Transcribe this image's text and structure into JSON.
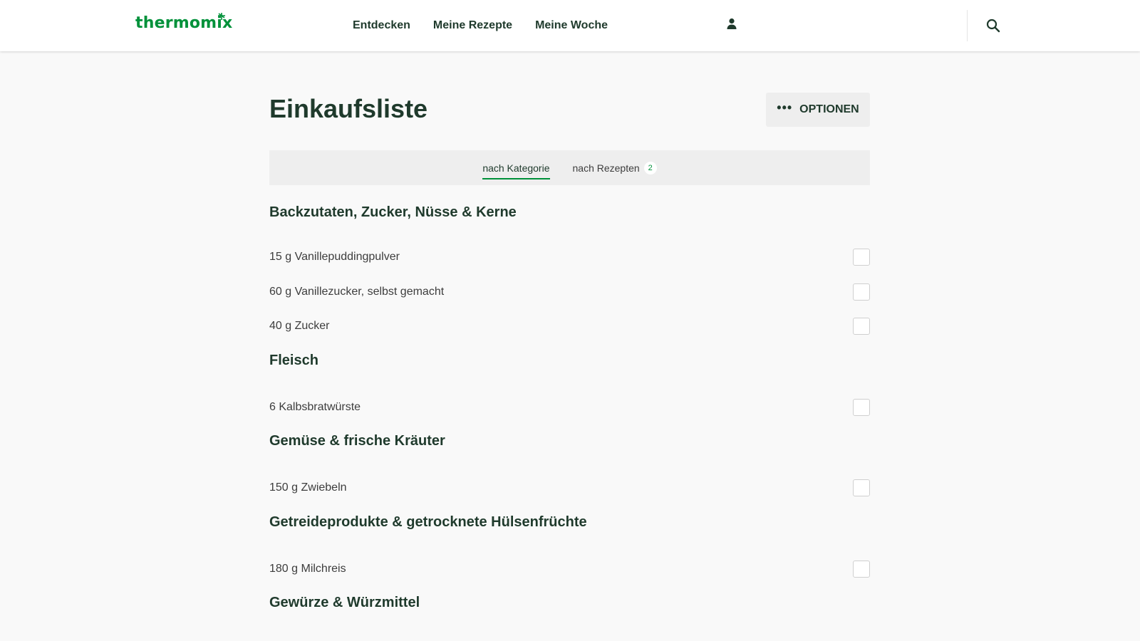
{
  "brand": {
    "logo_text": "thermomix",
    "color": "#00913a"
  },
  "nav": {
    "items": [
      {
        "label": "Entdecken"
      },
      {
        "label": "Meine Rezepte"
      },
      {
        "label": "Meine Woche"
      }
    ],
    "user_icon": "user-icon",
    "search_icon": "search-icon"
  },
  "page": {
    "title": "Einkaufsliste",
    "options_label": "OPTIONEN"
  },
  "tabs": [
    {
      "label": "nach Kategorie",
      "active": true
    },
    {
      "label": "nach Rezepten",
      "badge": "2",
      "active": false
    }
  ],
  "categories": [
    {
      "title": "Backzutaten, Zucker, Nüsse & Kerne",
      "items": [
        {
          "text": "15 g Vanillepuddingpulver",
          "checked": false
        },
        {
          "text": "60 g Vanillezucker, selbst gemacht",
          "checked": false
        },
        {
          "text": "40 g Zucker",
          "checked": false
        }
      ]
    },
    {
      "title": "Fleisch",
      "items": [
        {
          "text": "6 Kalbsbratwürste",
          "checked": false
        }
      ]
    },
    {
      "title": "Gemüse & frische Kräuter",
      "items": [
        {
          "text": "150 g Zwiebeln",
          "checked": false
        }
      ]
    },
    {
      "title": "Getreideprodukte & getrocknete Hülsenfrüchte",
      "items": [
        {
          "text": "180 g Milchreis",
          "checked": false
        }
      ]
    },
    {
      "title": "Gewürze & Würzmittel",
      "items": []
    }
  ]
}
